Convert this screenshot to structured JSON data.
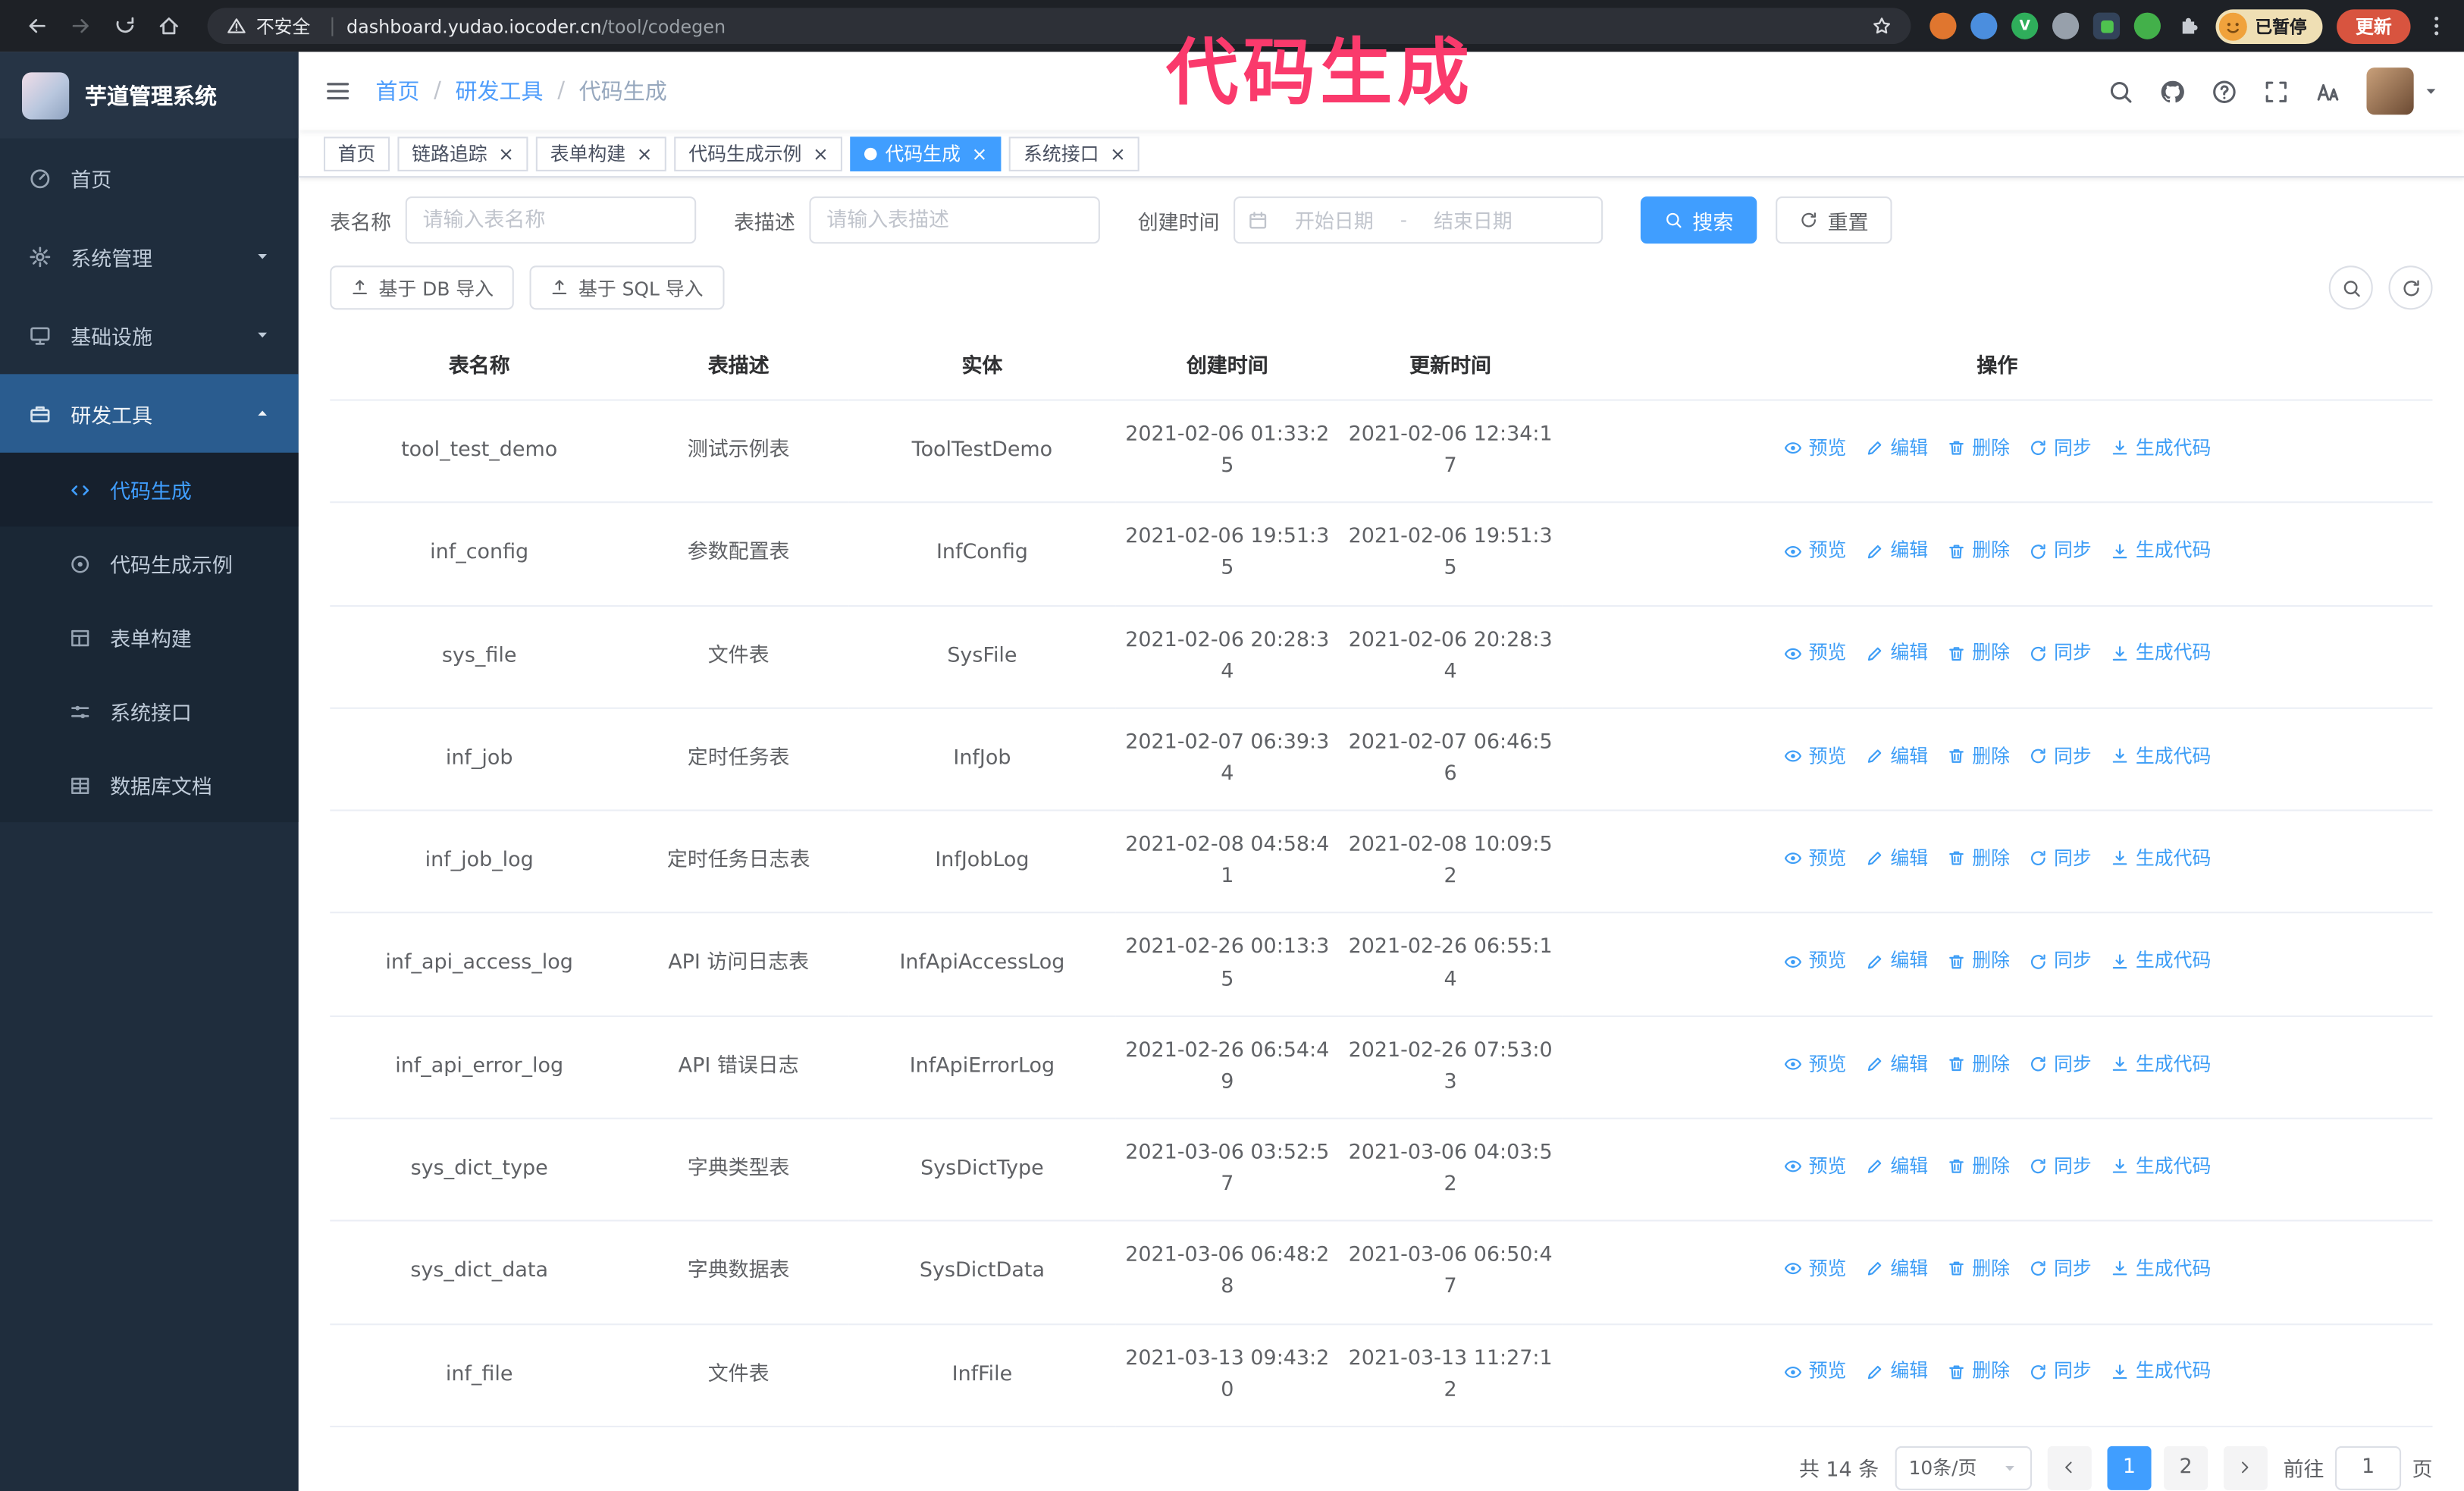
{
  "colors": {
    "accent": "#409eff",
    "sidebar_bg": "#1f2d3d",
    "chrome_bg": "#1e2126",
    "annotation": "#fa3a6c",
    "update_button": "#d8543f",
    "paused_chip": "#efdfb4",
    "active_tab": "#409eff"
  },
  "annotation": {
    "text": "代码生成"
  },
  "browser": {
    "security_label": "不安全",
    "url_host": "dashboard.yudao.iocoder.cn",
    "url_path": "/tool/codegen",
    "paused_badge": "已暂停",
    "update_button": "更新",
    "extensions": [
      {
        "name": "extension-icon-orange",
        "color": "#e0762f",
        "shape": "circle"
      },
      {
        "name": "extension-icon-blue",
        "color": "#4b8ede",
        "shape": "circle"
      },
      {
        "name": "extension-icon-green-v",
        "color": "#2fae5b",
        "shape": "circle",
        "glyph": "V"
      },
      {
        "name": "extension-icon-gray",
        "color": "#97a0ab",
        "shape": "circle"
      },
      {
        "name": "extension-icon-card",
        "color": "#33435a",
        "shape": "square",
        "inner": "#4fc34f"
      },
      {
        "name": "extension-icon-leaf",
        "color": "#43b04a",
        "shape": "circle"
      }
    ]
  },
  "sidebar": {
    "logo_title": "芋道管理系统",
    "menu": [
      {
        "key": "home",
        "label": "首页",
        "icon": "gauge"
      },
      {
        "key": "system-management",
        "label": "系统管理",
        "icon": "gear",
        "arrow": "down"
      },
      {
        "key": "infrastructure",
        "label": "基础设施",
        "icon": "monitor",
        "arrow": "down"
      },
      {
        "key": "dev-tools",
        "label": "研发工具",
        "icon": "tools",
        "arrow": "up",
        "highlight": true,
        "children": [
          {
            "key": "code-generation",
            "label": "代码生成",
            "icon": "code",
            "active": true
          },
          {
            "key": "code-gen-example",
            "label": "代码生成示例",
            "icon": "target"
          },
          {
            "key": "form-builder",
            "label": "表单构建",
            "icon": "form"
          },
          {
            "key": "system-api",
            "label": "系统接口",
            "icon": "sliders"
          },
          {
            "key": "db-doc",
            "label": "数据库文档",
            "icon": "grid"
          }
        ]
      }
    ]
  },
  "breadcrumb": [
    "首页",
    "研发工具",
    "代码生成"
  ],
  "tabs": [
    {
      "key": "home",
      "label": "首页"
    },
    {
      "key": "tracing",
      "label": "链路追踪",
      "closable": true
    },
    {
      "key": "form-builder",
      "label": "表单构建",
      "closable": true
    },
    {
      "key": "codegen-example",
      "label": "代码生成示例",
      "closable": true
    },
    {
      "key": "codegen",
      "label": "代码生成",
      "closable": true,
      "active": true
    },
    {
      "key": "system-api",
      "label": "系统接口",
      "closable": true
    }
  ],
  "filters": {
    "table_name_label": "表名称",
    "table_name_placeholder": "请输入表名称",
    "table_desc_label": "表描述",
    "table_desc_placeholder": "请输入表描述",
    "create_time_label": "创建时间",
    "date_start_placeholder": "开始日期",
    "date_separator": "-",
    "date_end_placeholder": "结束日期",
    "search_button": "搜索",
    "reset_button": "重置"
  },
  "toolbar": {
    "import_db": "基于 DB 导入",
    "import_sql": "基于 SQL 导入"
  },
  "table": {
    "columns": [
      {
        "key": "name",
        "label": "表名称"
      },
      {
        "key": "desc",
        "label": "表描述"
      },
      {
        "key": "entity",
        "label": "实体"
      },
      {
        "key": "created",
        "label": "创建时间"
      },
      {
        "key": "updated",
        "label": "更新时间"
      },
      {
        "key": "actions",
        "label": "操作"
      }
    ],
    "actions": [
      {
        "key": "preview",
        "label": "预览",
        "icon": "eye"
      },
      {
        "key": "edit",
        "label": "编辑",
        "icon": "edit"
      },
      {
        "key": "delete",
        "label": "删除",
        "icon": "trash"
      },
      {
        "key": "sync",
        "label": "同步",
        "icon": "sync"
      },
      {
        "key": "generate-code",
        "label": "生成代码",
        "icon": "download"
      }
    ],
    "rows": [
      {
        "name": "tool_test_demo",
        "desc": "测试示例表",
        "entity": "ToolTestDemo",
        "created": "2021-02-06 01:33:25",
        "updated": "2021-02-06 12:34:17"
      },
      {
        "name": "inf_config",
        "desc": "参数配置表",
        "entity": "InfConfig",
        "created": "2021-02-06 19:51:35",
        "updated": "2021-02-06 19:51:35"
      },
      {
        "name": "sys_file",
        "desc": "文件表",
        "entity": "SysFile",
        "created": "2021-02-06 20:28:34",
        "updated": "2021-02-06 20:28:34"
      },
      {
        "name": "inf_job",
        "desc": "定时任务表",
        "entity": "InfJob",
        "created": "2021-02-07 06:39:34",
        "updated": "2021-02-07 06:46:56"
      },
      {
        "name": "inf_job_log",
        "desc": "定时任务日志表",
        "entity": "InfJobLog",
        "created": "2021-02-08 04:58:41",
        "updated": "2021-02-08 10:09:52"
      },
      {
        "name": "inf_api_access_log",
        "desc": "API 访问日志表",
        "entity": "InfApiAccessLog",
        "created": "2021-02-26 00:13:35",
        "updated": "2021-02-26 06:55:14"
      },
      {
        "name": "inf_api_error_log",
        "desc": "API 错误日志",
        "entity": "InfApiErrorLog",
        "created": "2021-02-26 06:54:49",
        "updated": "2021-02-26 07:53:03"
      },
      {
        "name": "sys_dict_type",
        "desc": "字典类型表",
        "entity": "SysDictType",
        "created": "2021-03-06 03:52:57",
        "updated": "2021-03-06 04:03:52"
      },
      {
        "name": "sys_dict_data",
        "desc": "字典数据表",
        "entity": "SysDictData",
        "created": "2021-03-06 06:48:28",
        "updated": "2021-03-06 06:50:47"
      },
      {
        "name": "inf_file",
        "desc": "文件表",
        "entity": "InfFile",
        "created": "2021-03-13 09:43:20",
        "updated": "2021-03-13 11:27:12"
      }
    ]
  },
  "pagination": {
    "total_text": "共 14 条",
    "page_size": "10条/页",
    "pages": [
      "1",
      "2"
    ],
    "active_page": "1",
    "goto_label": "前往",
    "goto_value": "1",
    "goto_suffix": "页"
  }
}
